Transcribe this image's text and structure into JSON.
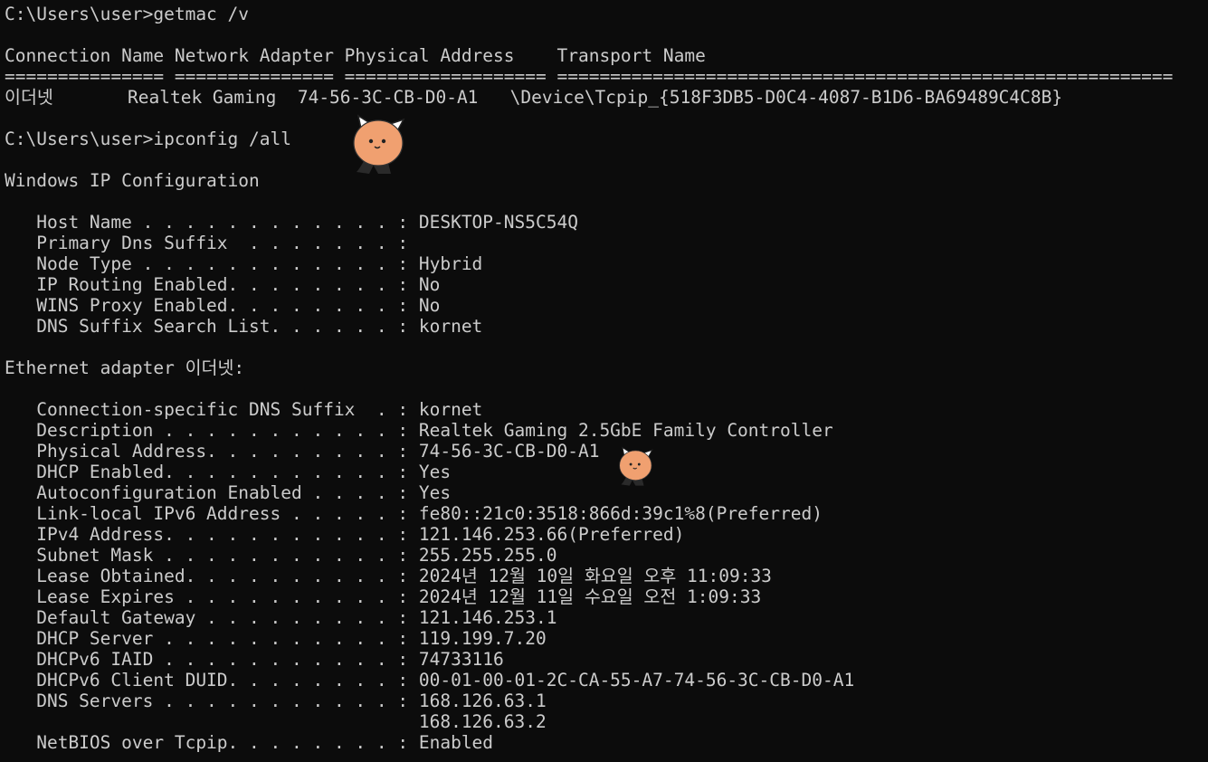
{
  "colors": {
    "background": "#0c0c0c",
    "foreground": "#cccccc",
    "sticker_face": "#f0a070",
    "sticker_ear": "#ffffff",
    "sticker_body": "#2a2a2a"
  },
  "getmac": {
    "prompt": "C:\\Users\\user>getmac /v",
    "header": "Connection Name Network Adapter Physical Address    Transport Name",
    "separator": "=============== =============== =================== ==========================================================",
    "row": "이더넷       Realtek Gaming  74-56-3C-CB-D0-A1   \\Device\\Tcpip_{518F3DB5-D0C4-4087-B1D6-BA69489C4C8B}"
  },
  "ipconfig": {
    "prompt": "C:\\Users\\user>ipconfig /all",
    "title": "Windows IP Configuration",
    "general": [
      "   Host Name . . . . . . . . . . . . : DESKTOP-NS5C54Q",
      "   Primary Dns Suffix  . . . . . . . :",
      "   Node Type . . . . . . . . . . . . : Hybrid",
      "   IP Routing Enabled. . . . . . . . : No",
      "   WINS Proxy Enabled. . . . . . . . : No",
      "   DNS Suffix Search List. . . . . . : kornet"
    ],
    "adapter_title": "Ethernet adapter 이더넷:",
    "adapter": [
      "   Connection-specific DNS Suffix  . : kornet",
      "   Description . . . . . . . . . . . : Realtek Gaming 2.5GbE Family Controller",
      "   Physical Address. . . . . . . . . : 74-56-3C-CB-D0-A1",
      "   DHCP Enabled. . . . . . . . . . . : Yes",
      "   Autoconfiguration Enabled . . . . : Yes",
      "   Link-local IPv6 Address . . . . . : fe80::21c0:3518:866d:39c1%8(Preferred)",
      "   IPv4 Address. . . . . . . . . . . : 121.146.253.66(Preferred)",
      "   Subnet Mask . . . . . . . . . . . : 255.255.255.0",
      "   Lease Obtained. . . . . . . . . . : 2024년 12월 10일 화요일 오후 11:09:33",
      "   Lease Expires . . . . . . . . . . : 2024년 12월 11일 수요일 오전 1:09:33",
      "   Default Gateway . . . . . . . . . : 121.146.253.1",
      "   DHCP Server . . . . . . . . . . . : 119.199.7.20",
      "   DHCPv6 IAID . . . . . . . . . . . : 74733116",
      "   DHCPv6 Client DUID. . . . . . . . : 00-01-00-01-2C-CA-55-A7-74-56-3C-CB-D0-A1",
      "   DNS Servers . . . . . . . . . . . : 168.126.63.1",
      "                                       168.126.63.2",
      "   NetBIOS over Tcpip. . . . . . . . : Enabled"
    ]
  }
}
